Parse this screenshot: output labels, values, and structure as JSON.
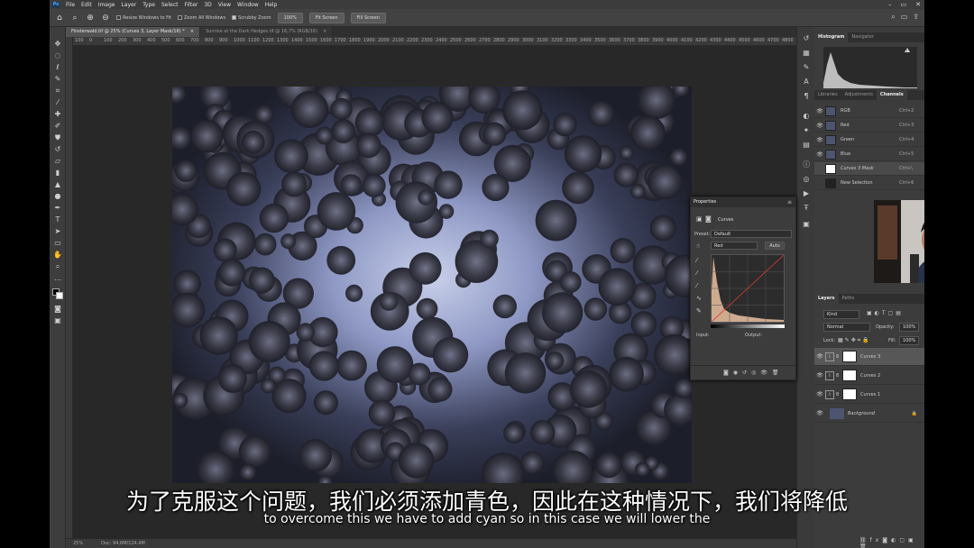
{
  "menu": {
    "items": [
      "File",
      "Edit",
      "Image",
      "Layer",
      "Type",
      "Select",
      "Filter",
      "3D",
      "View",
      "Window",
      "Help"
    ]
  },
  "options": {
    "resize_windows": "Resize Windows to Fit",
    "zoom_all": "Zoom All Windows",
    "scrubby_zoom": "Scrubby Zoom",
    "zoom_pct": "100%",
    "fit_screen": "Fit Screen",
    "fill_screen": "Fill Screen"
  },
  "tabs": [
    {
      "label": "Finsterwald.tif @ 25% (Curves 3, Layer Mask/16) *",
      "active": true
    },
    {
      "label": "Sunrise at the Dark Hedges.tif @ 16,7% (RGB/16)",
      "active": false
    }
  ],
  "ruler_ticks": [
    "100",
    "0",
    "100",
    "200",
    "300",
    "400",
    "500",
    "600",
    "700",
    "800",
    "900",
    "1000",
    "1100",
    "1200",
    "1300",
    "1400",
    "1500",
    "1600",
    "1700",
    "1800",
    "1900",
    "2000",
    "2100",
    "2200",
    "2300",
    "2400",
    "2500",
    "2600",
    "2700",
    "2800",
    "2900",
    "3000",
    "3100",
    "3200",
    "3300",
    "3400",
    "3500",
    "3600",
    "3700",
    "3800",
    "3900",
    "4000",
    "4100",
    "4200",
    "4300",
    "4400",
    "4500",
    "4600",
    "4700",
    "4800"
  ],
  "status": {
    "zoom": "25%",
    "doc": "Doc: 94,6M/124,4M"
  },
  "histogram_tabs": [
    "Histogram",
    "Navigator"
  ],
  "channel_tabs": [
    "Libraries",
    "Adjustments",
    "Channels"
  ],
  "channels": [
    {
      "name": "RGB",
      "shortcut": "Ctrl+2"
    },
    {
      "name": "Red",
      "shortcut": "Ctrl+3"
    },
    {
      "name": "Green",
      "shortcut": "Ctrl+4"
    },
    {
      "name": "Blue",
      "shortcut": "Ctrl+5"
    },
    {
      "name": "Curves 3 Mask",
      "shortcut": "Ctrl+\\"
    },
    {
      "name": "New Selection",
      "shortcut": "Ctrl+6"
    }
  ],
  "properties": {
    "title": "Properties",
    "type": "Curves",
    "preset_label": "Preset:",
    "preset_value": "Default",
    "channel_value": "Red",
    "auto_label": "Auto",
    "input_label": "Input:",
    "output_label": "Output:"
  },
  "layers_tabs": [
    "Layers",
    "Paths"
  ],
  "layers_panel": {
    "kind": "Kind",
    "blend": "Normal",
    "opacity_label": "Opacity:",
    "opacity": "100%",
    "lock_label": "Lock:",
    "fill_label": "Fill:",
    "fill": "100%"
  },
  "layers": [
    {
      "name": "Curves 3"
    },
    {
      "name": "Curves 2"
    },
    {
      "name": "Curves 1"
    },
    {
      "name": "Background"
    }
  ],
  "subtitles": {
    "zh": "为了克服这个问题，我们必须添加青色，因此在这种情况下，我们将降低",
    "en": "to overcome this we have to add cyan so in this case we will lower the"
  }
}
